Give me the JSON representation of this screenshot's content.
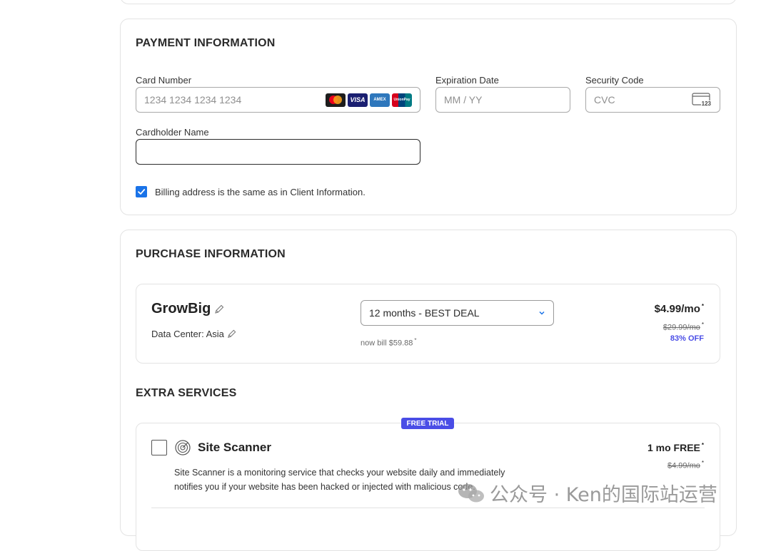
{
  "payment": {
    "title": "PAYMENT INFORMATION",
    "card_number_label": "Card Number",
    "card_number_placeholder": "1234 1234 1234 1234",
    "expiration_label": "Expiration Date",
    "expiration_placeholder": "MM / YY",
    "security_label": "Security Code",
    "security_placeholder": "CVC",
    "cvc_icon_text": "123",
    "cardholder_label": "Cardholder Name",
    "cardholder_value": "",
    "billing_same_label": "Billing address is the same as in Client Information.",
    "billing_same_checked": true,
    "card_brands": [
      {
        "name": "mastercard",
        "label": ""
      },
      {
        "name": "visa",
        "label": "VISA"
      },
      {
        "name": "amex",
        "label": "AMEX"
      },
      {
        "name": "unionpay",
        "label": "UnionPay"
      }
    ]
  },
  "purchase": {
    "title": "PURCHASE INFORMATION",
    "plan_name": "GrowBig",
    "data_center": "Data Center: Asia",
    "period_selected": "12 months - BEST DEAL",
    "bill_note": "now bill $59.88",
    "price": "$4.99/mo",
    "old_price": "$29.99/mo",
    "discount": "83% OFF"
  },
  "extras": {
    "title": "EXTRA SERVICES",
    "badge": "FREE TRIAL",
    "service_name": "Site Scanner",
    "service_desc_line1": "Site Scanner is a monitoring service that checks your website daily and immediately",
    "service_desc_line2": "notifies you if your website has been hacked or injected with malicious code.",
    "service_price": "1 mo FREE",
    "service_old_price": "$4.99/mo",
    "service_checked": false
  },
  "watermark": {
    "text": "公众号 · Ken的国际站运营"
  },
  "colors": {
    "accent": "#1a73e8",
    "badge_bg": "#4a4de6",
    "discount": "#4a4de6"
  }
}
